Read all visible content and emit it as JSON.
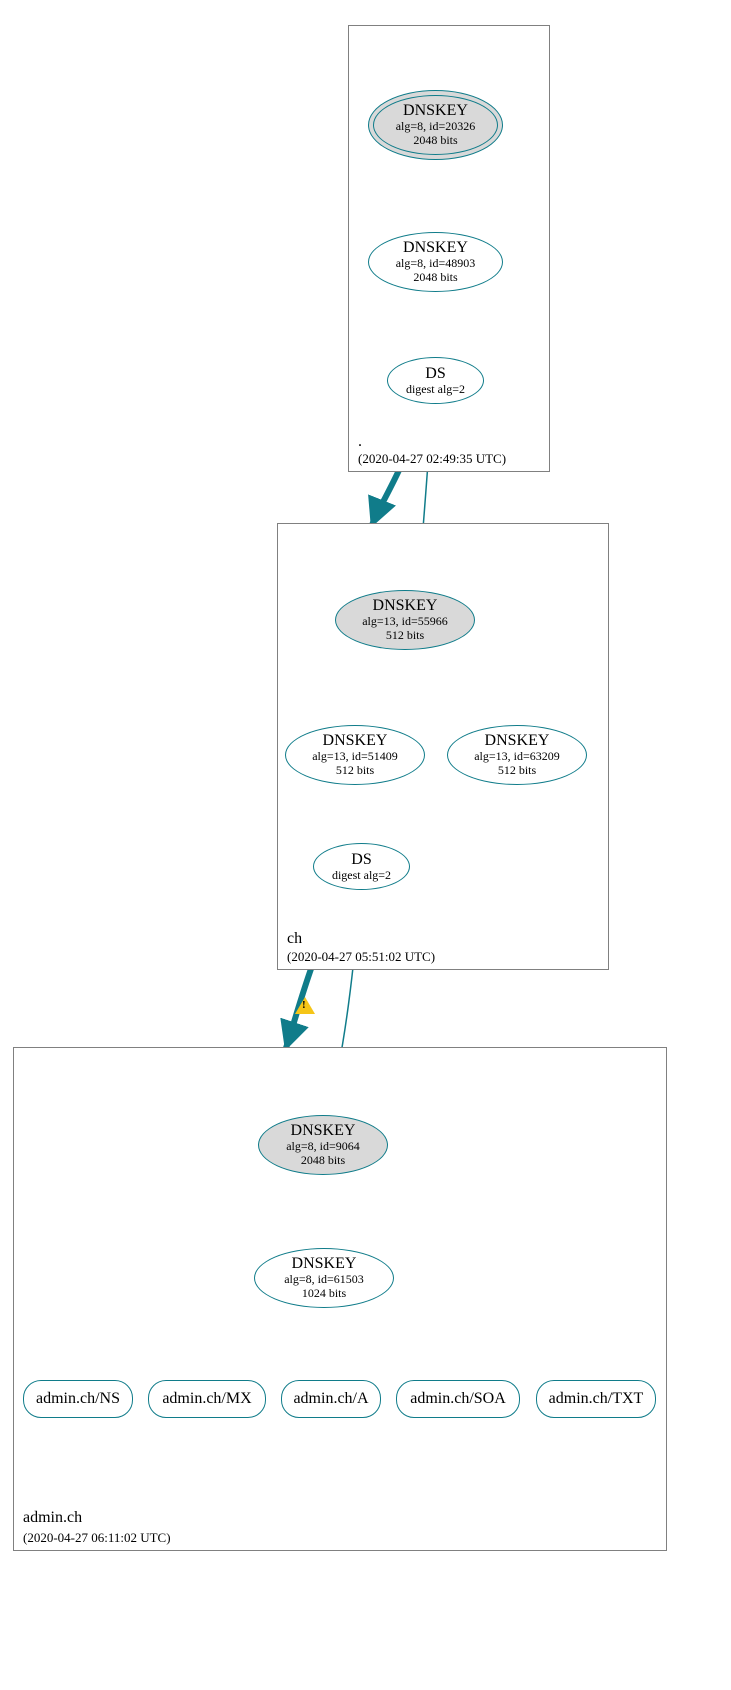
{
  "colors": {
    "stroke": "#107c8a",
    "box": "#808080",
    "fill": "#d9d9d9",
    "warn": "#f5c518"
  },
  "zones": {
    "root": {
      "name": ".",
      "timestamp": "(2020-04-27 02:49:35 UTC)",
      "nodes": {
        "ksk": {
          "t": "DNSKEY",
          "s1": "alg=8, id=20326",
          "s2": "2048 bits"
        },
        "zsk": {
          "t": "DNSKEY",
          "s1": "alg=8, id=48903",
          "s2": "2048 bits"
        },
        "ds": {
          "t": "DS",
          "s1": "digest alg=2",
          "s2": ""
        }
      }
    },
    "ch": {
      "name": "ch",
      "timestamp": "(2020-04-27 05:51:02 UTC)",
      "nodes": {
        "ksk": {
          "t": "DNSKEY",
          "s1": "alg=13, id=55966",
          "s2": "512 bits"
        },
        "zsk": {
          "t": "DNSKEY",
          "s1": "alg=13, id=51409",
          "s2": "512 bits"
        },
        "zsk2": {
          "t": "DNSKEY",
          "s1": "alg=13, id=63209",
          "s2": "512 bits"
        },
        "ds": {
          "t": "DS",
          "s1": "digest alg=2",
          "s2": ""
        }
      }
    },
    "admin": {
      "name": "admin.ch",
      "timestamp": "(2020-04-27 06:11:02 UTC)",
      "nodes": {
        "ksk": {
          "t": "DNSKEY",
          "s1": "alg=8, id=9064",
          "s2": "2048 bits"
        },
        "zsk": {
          "t": "DNSKEY",
          "s1": "alg=8, id=61503",
          "s2": "1024 bits"
        }
      },
      "rrsets": {
        "ns": "admin.ch/NS",
        "mx": "admin.ch/MX",
        "a": "admin.ch/A",
        "soa": "admin.ch/SOA",
        "txt": "admin.ch/TXT"
      }
    }
  }
}
